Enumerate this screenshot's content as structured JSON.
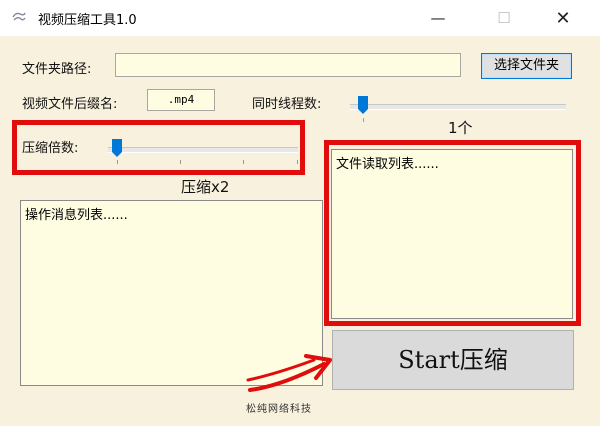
{
  "window": {
    "title": "视频压缩工具1.0",
    "controls": {
      "minimize": "—",
      "maximize": "☐",
      "close": "✕"
    }
  },
  "form": {
    "folder_label": "文件夹路径:",
    "folder_value": "",
    "select_button": "选择文件夹",
    "ext_label": "视频文件后缀名:",
    "ext_value": ".mp4",
    "threads_label": "同时线程数:",
    "threads_value": "1个",
    "threads_level": 0,
    "compress_label": "压缩倍数:",
    "compress_value": "压缩x2",
    "compress_level": 0
  },
  "lists": {
    "file_list_text": "文件读取列表......",
    "log_list_text": "操作消息列表......"
  },
  "start_button": "Start压缩",
  "watermark": "松纯网络科技",
  "colors": {
    "window_bg": "#f8f1de",
    "field_bg": "#fffde1",
    "annotation_red": "#e10d0d",
    "slider_thumb": "#0078d7"
  }
}
